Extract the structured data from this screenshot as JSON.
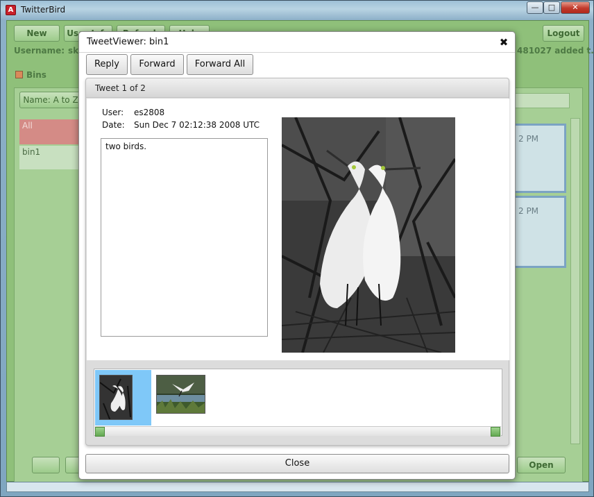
{
  "os_window": {
    "title": "TwitterBird",
    "app_icon": "adobe-air-icon",
    "controls": [
      "minimize-icon",
      "maximize-icon",
      "close-icon"
    ]
  },
  "background_app": {
    "toolbar": [
      "New",
      "User Info",
      "Refresh",
      "Help"
    ],
    "logout_label": "Logout",
    "username_label": "Username:",
    "username_value": "sk",
    "status_fragment": "481027 added t...",
    "bins_label": "Bins",
    "sort_label": "Name: A to Z",
    "bin_items": [
      "All",
      "bin1"
    ],
    "card_time_1": "2 PM",
    "card_time_2": "2 PM",
    "open_label": "Open"
  },
  "dialog": {
    "title": "TweetViewer: bin1",
    "close_icon": "close-x-icon",
    "buttons": {
      "reply": "Reply",
      "forward": "Forward",
      "forward_all": "Forward All"
    },
    "tweet_header": "Tweet 1 of 2",
    "user_label": "User:",
    "user_value": "es2808",
    "date_label": "Date:",
    "date_value": "Sun Dec 7 02:12:38 2008 UTC",
    "tweet_text": "two birds.",
    "close_label": "Close"
  }
}
